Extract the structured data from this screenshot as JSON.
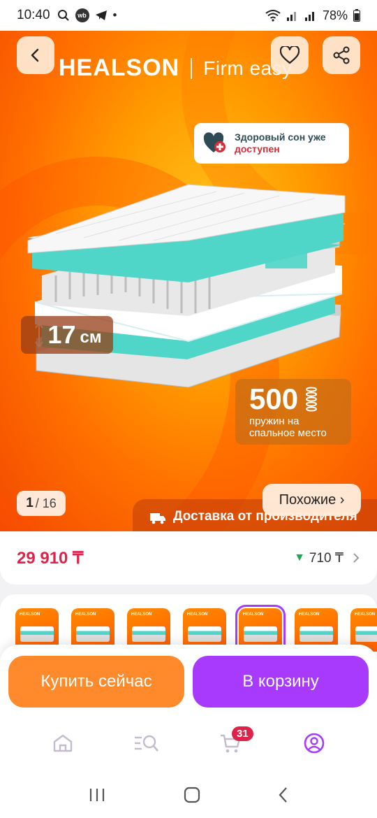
{
  "status_bar": {
    "time": "10:40",
    "battery": "78%"
  },
  "hero": {
    "brand": "HEALSON",
    "model": "Firm easy",
    "health_card": {
      "line1": "Здоровый сон уже",
      "line2": "доступен"
    },
    "height_badge": {
      "value": "17",
      "unit": "см"
    },
    "springs": {
      "value": "500",
      "line1": "пружин на",
      "line2": "спальное место"
    },
    "counter": {
      "current": "1",
      "total": "/ 16"
    },
    "similar_label": "Похожие ›",
    "delivery_label": "Доставка от производителя"
  },
  "price": {
    "value": "29 910 ₸",
    "bonus": "710 ₸"
  },
  "thumbnails": {
    "count": 7,
    "selected_index": 4,
    "logo": "HEALSON"
  },
  "actions": {
    "buy_now": "Купить сейчас",
    "add_to_cart": "В корзину"
  },
  "bottom_nav": {
    "cart_count": "31"
  },
  "colors": {
    "accent_purple": "#a73afd",
    "accent_orange": "#ff8a2b",
    "price_red": "#e0224a",
    "bonus_green": "#1fa950"
  }
}
